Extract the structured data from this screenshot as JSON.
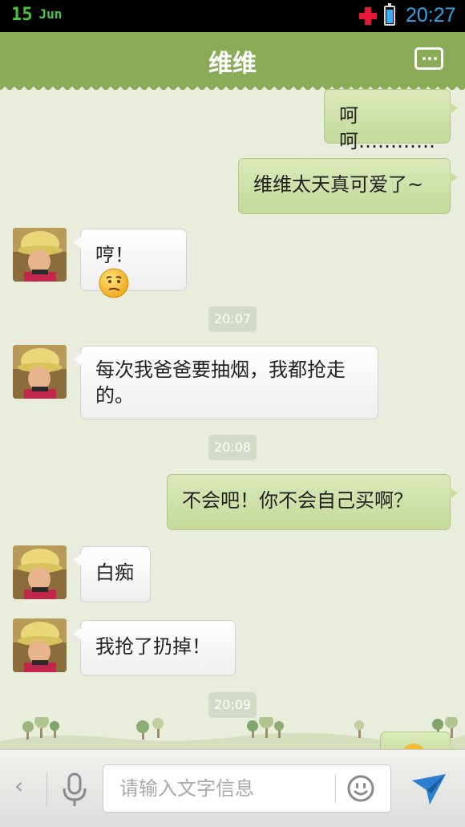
{
  "status_bar": {
    "day": "15",
    "month": "Jun",
    "time": "20:27",
    "battery_level_percent": 80,
    "colors": {
      "date": "#49c63a",
      "time": "#2aa6e8",
      "alert_plus": "#e8173a"
    }
  },
  "header": {
    "title": "维维",
    "menu_icon": "chat-menu-icon",
    "background": "#8aab57"
  },
  "messages": [
    {
      "side": "out",
      "text": "呵呵…………"
    },
    {
      "side": "out",
      "text": "维维太天真可爱了~"
    },
    {
      "side": "in",
      "text": "哼！",
      "emoji": "puzzled-face-emoji"
    },
    {
      "timestamp": "20:07"
    },
    {
      "side": "in",
      "text": "每次我爸爸要抽烟，我都抢走的。"
    },
    {
      "timestamp": "20:08"
    },
    {
      "side": "out",
      "text": "不会吧！你不会自己买啊？"
    },
    {
      "side": "in",
      "text": "白痴"
    },
    {
      "side": "in",
      "text": "我抢了扔掉！"
    },
    {
      "timestamp": "20:09"
    }
  ],
  "input_bar": {
    "placeholder": "请输入文字信息",
    "back_label": "‹",
    "mic_icon": "microphone-icon",
    "emoji_icon": "smiley-icon",
    "send_icon": "send-arrow-icon"
  },
  "colors": {
    "chat_background": "#e8eedb",
    "outgoing_bubble": "#cfe0a8",
    "incoming_bubble": "#f6f6f6",
    "send_icon": "#2c7fd1"
  }
}
